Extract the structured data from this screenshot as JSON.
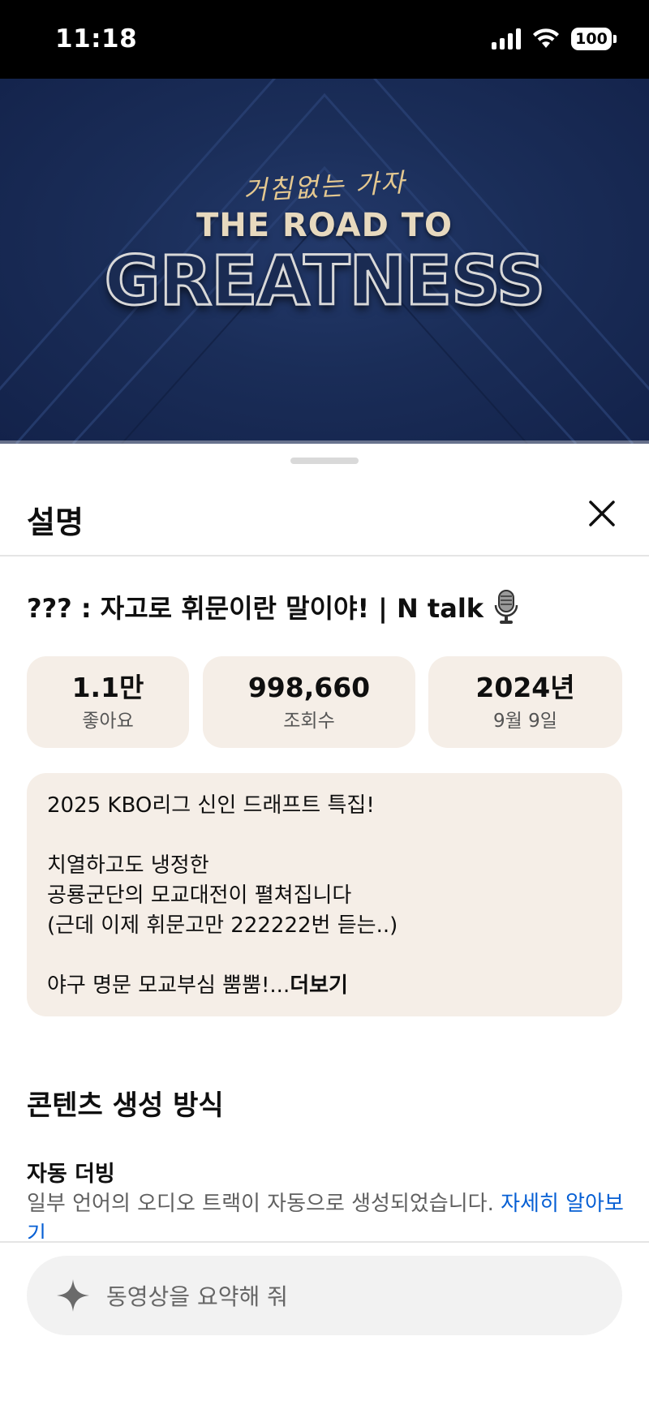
{
  "status_bar": {
    "time": "11:18",
    "battery": "100",
    "icons": [
      "signal-icon",
      "wifi-icon",
      "battery-icon"
    ]
  },
  "video": {
    "brand_text": "거침없는 가자",
    "subtitle": "THE ROAD TO",
    "title": "GREATNESS"
  },
  "sheet": {
    "title": "설명",
    "close_icon": "close-icon",
    "video_title": "??? : 자고로 휘문이란 말이야! | N talk",
    "title_icon": "microphone-icon",
    "stats": [
      {
        "value": "1.1만",
        "label": "좋아요"
      },
      {
        "value": "998,660",
        "label": "조회수"
      },
      {
        "value": "2024년",
        "label": "9월 9일"
      }
    ],
    "description": {
      "lines": [
        "2025 KBO리그 신인 드래프트 특집!",
        "",
        "치열하고도 냉정한",
        "공룡군단의 모교대전이 펼쳐집니다",
        "(근데 이제 휘문고만 222222번 듣는..)",
        "",
        "야구 명문 모교부심 뿜뿜!..."
      ],
      "more_label": "더보기"
    },
    "content_section": {
      "heading": "콘텐츠 생성 방식",
      "item_title": "자동 더빙",
      "item_text": "일부 언어의 오디오 트랙이 자동으로 생성되었습니다.",
      "item_link": "자세히 알아보기"
    },
    "ask": {
      "placeholder": "동영상을 요약해 줘",
      "icon": "sparkle-icon"
    }
  },
  "colors": {
    "stat_bg": "#f5eee7",
    "link": "#065fd4",
    "video_bg": "#1a2d58"
  }
}
